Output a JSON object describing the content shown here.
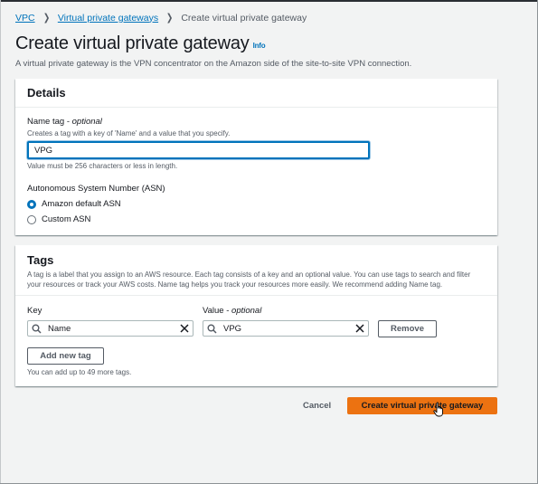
{
  "breadcrumb": {
    "items": [
      "VPC",
      "Virtual private gateways"
    ],
    "current": "Create virtual private gateway"
  },
  "page": {
    "title": "Create virtual private gateway",
    "info": "Info",
    "description": "A virtual private gateway is the VPN concentrator on the Amazon side of the site-to-site VPN connection."
  },
  "details": {
    "title": "Details",
    "name_tag": {
      "label": "Name tag",
      "label_suffix": "optional",
      "description": "Creates a tag with a key of 'Name' and a value that you specify.",
      "value": "VPG",
      "constraint": "Value must be 256 characters or less in length."
    },
    "asn": {
      "label": "Autonomous System Number (ASN)",
      "options": [
        {
          "label": "Amazon default ASN",
          "selected": true
        },
        {
          "label": "Custom ASN",
          "selected": false
        }
      ]
    }
  },
  "tags": {
    "title": "Tags",
    "description_line1": "A tag is a label that you assign to an AWS resource. Each tag consists of a key and an optional value. You can use tags to search and filter",
    "description_line2": "your resources or track your AWS costs. Name tag helps you track your resources more easily. We recommend adding Name tag.",
    "key_label": "Key",
    "value_label": "Value",
    "value_label_suffix": "optional",
    "rows": [
      {
        "key": "Name",
        "value": "VPG"
      }
    ],
    "remove_label": "Remove",
    "add_label": "Add new tag",
    "limit_text": "You can add up to 49 more tags."
  },
  "actions": {
    "cancel": "Cancel",
    "create": "Create virtual private gateway"
  },
  "colors": {
    "link": "#0073bb",
    "primary": "#ec7211",
    "background": "#f2f3f3"
  },
  "icons": {
    "breadcrumb_separator": "chevron-right-icon",
    "search": "search-icon",
    "clear": "close-icon",
    "cursor": "hand-pointer-icon"
  }
}
